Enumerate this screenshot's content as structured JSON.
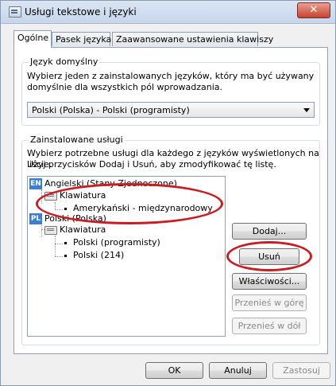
{
  "window": {
    "title": "Usługi tekstowe i języki",
    "close_symbol": "✕"
  },
  "tabs": [
    {
      "label": "Ogólne",
      "active": true
    },
    {
      "label": "Pasek języka",
      "active": false
    },
    {
      "label": "Zaawansowane ustawienia klawiszy",
      "active": false
    }
  ],
  "default_language": {
    "group_label": "Język domyślny",
    "description_line1": "Wybierz jeden z zainstalowanych języków, który ma być używany",
    "description_line2": "domyślnie dla wszystkich pól wprowadzania.",
    "selected": "Polski (Polska) - Polski (programisty)"
  },
  "installed_services": {
    "group_label": "Zainstalowane usługi",
    "description_line1": "Wybierz potrzebne usługi dla każdego z języków wyświetlonych na liście.",
    "description_line2": "Użyj przycisków Dodaj i Usuń, aby zmodyfikować tę listę.",
    "tree": [
      {
        "badge": "EN",
        "language": "Angielski (Stany Zjednoczone)",
        "keyboard_label": "Klawiatura",
        "layouts": [
          "Amerykański - międzynarodowy"
        ]
      },
      {
        "badge": "PL",
        "language": "Polski (Polska)",
        "keyboard_label": "Klawiatura",
        "layouts": [
          "Polski (programisty)",
          "Polski (214)"
        ]
      }
    ]
  },
  "side_buttons": {
    "add": "Dodaj...",
    "remove": "Usuń",
    "properties": "Właściwości...",
    "move_up": "Przenieś w górę",
    "move_down": "Przenieś w dół"
  },
  "footer_buttons": {
    "ok": "OK",
    "cancel": "Anuluj",
    "apply": "Zastosuj"
  },
  "colors": {
    "annotation": "#c71d23",
    "lang_badge": "#3b7fd0"
  }
}
